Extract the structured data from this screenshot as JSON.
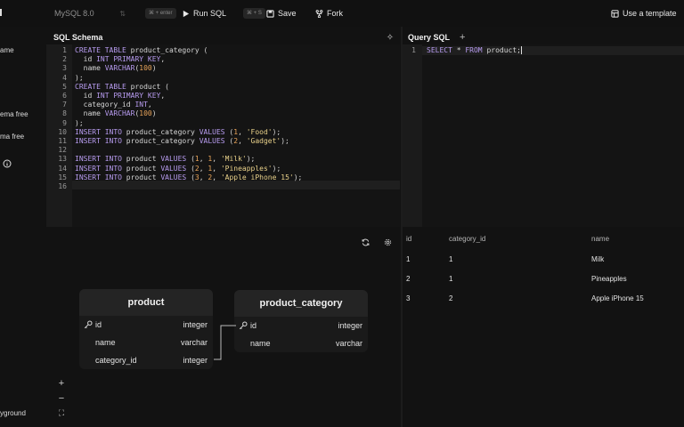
{
  "toolbar": {
    "db_select": "MySQL 8.0",
    "run_shortcut": "⌘ + enter",
    "run_label": "Run SQL",
    "save_shortcut": "⌘ + S",
    "save_label": "Save",
    "fork_label": "Fork",
    "template_label": "Use a template"
  },
  "sidebar": {
    "items": [
      "ame",
      "ema free",
      "ma free",
      "yground"
    ]
  },
  "schema": {
    "tab_label": "SQL Schema",
    "line_numbers": [
      "1",
      "2",
      "3",
      "4",
      "5",
      "6",
      "7",
      "8",
      "9",
      "10",
      "11",
      "12",
      "13",
      "14",
      "15",
      "16"
    ]
  },
  "query": {
    "tab_label": "Query SQL",
    "add_tab": "+",
    "line_number": "1"
  },
  "results": {
    "columns": [
      "id",
      "category_id",
      "name"
    ],
    "rows": [
      [
        "1",
        "1",
        "Milk"
      ],
      [
        "2",
        "1",
        "Pineapples"
      ],
      [
        "3",
        "2",
        "Apple iPhone 15"
      ]
    ]
  },
  "diagram": {
    "tables": [
      {
        "name": "product",
        "columns": [
          {
            "name": "id",
            "type": "integer",
            "key": true
          },
          {
            "name": "name",
            "type": "varchar",
            "key": false
          },
          {
            "name": "category_id",
            "type": "integer",
            "key": false
          }
        ]
      },
      {
        "name": "product_category",
        "columns": [
          {
            "name": "id",
            "type": "integer",
            "key": true
          },
          {
            "name": "name",
            "type": "varchar",
            "key": false
          }
        ]
      }
    ],
    "zoom_in": "+",
    "zoom_out": "−",
    "fit": "⛶"
  },
  "colors": {
    "keyword": "#b89cf0",
    "string": "#e9d18a",
    "number": "#e9a45a"
  }
}
